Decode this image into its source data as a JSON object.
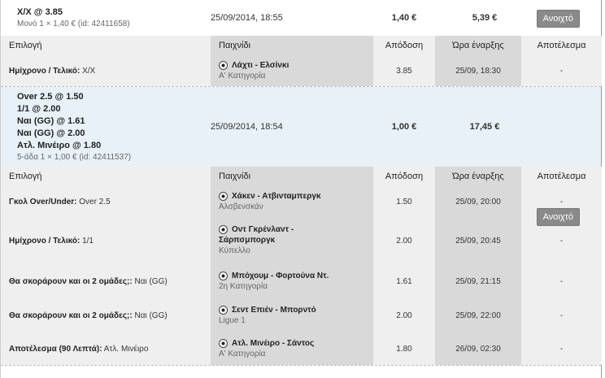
{
  "columns": {
    "selection": "Επιλογή",
    "game": "Παιχνίδι",
    "odds": "Απόδοση",
    "start": "Ώρα έναρξης",
    "result": "Αποτέλεσμα"
  },
  "bets": [
    {
      "selections": [
        "X/X @ 3.85"
      ],
      "subline": "Μονό 1 × 1,40 € (id: 42411658)",
      "date": "25/09/2014, 18:55",
      "stake": "1,40 €",
      "win": "5,39 €",
      "status_button": "Ανοιχτό",
      "legs": [
        {
          "market": "Ημίχρονο / Τελικό:",
          "pick": "X/X",
          "match_line1": "Λάχτι - Ελσίνκι",
          "match_line2": "",
          "league": "Α' Κατηγορία",
          "odds": "3.85",
          "start": "25/09, 18:30",
          "result": "-"
        }
      ]
    },
    {
      "selections": [
        "Over 2.5 @ 1.50",
        "1/1 @ 2.00",
        "Ναι (GG) @ 1.61",
        "Ναι (GG) @ 2.00",
        "Ατλ. Μινέιρο @ 1.80"
      ],
      "subline": "5-άδα 1 × 1,00 € (id: 42411537)",
      "date": "25/09/2014, 18:54",
      "stake": "1,00 €",
      "win": "17,45 €",
      "status_button": "Ανοιχτό",
      "legs": [
        {
          "market": "Γκολ Over/Under:",
          "pick": "Over 2.5",
          "match_line1": "Χάκεν - Ατβινταμπεργκ",
          "match_line2": "",
          "league": "Αλσβενσκάν",
          "odds": "1.50",
          "start": "25/09, 20:00",
          "result": "-"
        },
        {
          "market": "Ημίχρονο / Τελικό:",
          "pick": "1/1",
          "match_line1": "Οντ Γκρένλαντ -",
          "match_line2": "Σάρπσμποργκ",
          "league": "Κύπελλο",
          "odds": "2.00",
          "start": "25/09, 20:45",
          "result": "-"
        },
        {
          "market": "Θα σκοράρουν και οι 2 ομάδες;:",
          "pick": "Ναι (GG)",
          "match_line1": "Μπόχουμ - Φορτούνα Ντ.",
          "match_line2": "",
          "league": "2η Κατηγορία",
          "odds": "1.61",
          "start": "25/09, 21:15",
          "result": "-"
        },
        {
          "market": "Θα σκοράρουν και οι 2 ομάδες;:",
          "pick": "Ναι (GG)",
          "match_line1": "Σεντ Επιέν - Μπορντό",
          "match_line2": "",
          "league": "Ligue 1",
          "odds": "2.00",
          "start": "25/09, 22:00",
          "result": "-"
        },
        {
          "market": "Αποτέλεσμα (90 Λεπτά):",
          "pick": "Ατλ. Μινέιρο",
          "match_line1": "Ατλ. Μινέιρο - Σάντος",
          "match_line2": "",
          "league": "Α' Κατηγορία",
          "odds": "1.80",
          "start": "26/09, 02:30",
          "result": "-"
        }
      ]
    }
  ],
  "icons": {
    "match": "soccer-ball-icon"
  }
}
